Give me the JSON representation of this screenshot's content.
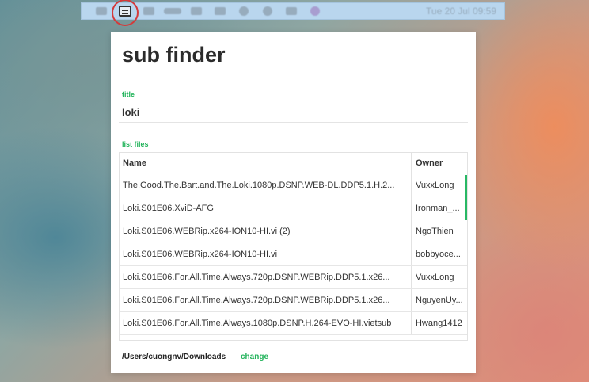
{
  "menubar": {
    "clock": "Tue 20 Jul 09:59"
  },
  "app": {
    "heading": "sub finder",
    "title_label": "title",
    "title_value": "loki",
    "list_label": "list files",
    "columns": {
      "name": "Name",
      "owner": "Owner"
    },
    "rows": [
      {
        "name": "The.Good.The.Bart.and.The.Loki.1080p.DSNP.WEB-DL.DDP5.1.H.2...",
        "owner": "VuxxLong"
      },
      {
        "name": "Loki.S01E06.XviD-AFG",
        "owner": "Ironman_..."
      },
      {
        "name": "Loki.S01E06.WEBRip.x264-ION10-HI.vi (2)",
        "owner": "NgoThien"
      },
      {
        "name": "Loki.S01E06.WEBRip.x264-ION10-HI.vi",
        "owner": "bobbyoce..."
      },
      {
        "name": "Loki.S01E06.For.All.Time.Always.720p.DSNP.WEBRip.DDP5.1.x26...",
        "owner": "VuxxLong"
      },
      {
        "name": "Loki.S01E06.For.All.Time.Always.720p.DSNP.WEBRip.DDP5.1.x26...",
        "owner": "NguyenUy..."
      },
      {
        "name": "Loki.S01E06.For.All.Time.Always.1080p.DSNP.H.264-EVO-HI.vietsub",
        "owner": "Hwang1412"
      }
    ],
    "download_path": "/Users/cuongnv/Downloads",
    "change_label": "change"
  },
  "colors": {
    "accent": "#21b35a",
    "highlight_ring": "#d43a3a",
    "menubar": "#b9d6ee"
  }
}
